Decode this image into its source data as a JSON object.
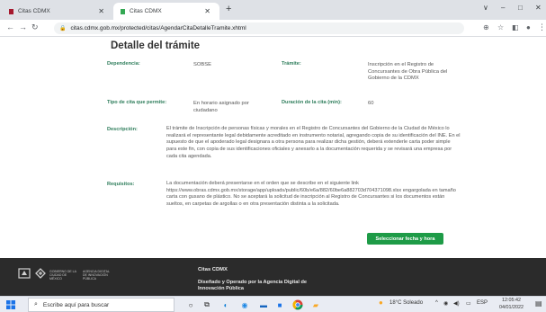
{
  "browser": {
    "tabs": [
      {
        "title": "Citas CDMX",
        "active": false
      },
      {
        "title": "Citas CDMX",
        "active": true
      }
    ],
    "new_tab_icon": "plus-icon",
    "url": "citas.cdmx.gob.mx/protected/citas/AgendarCitaDetalleTramite.xhtml",
    "window_controls": {
      "minimize": "∨",
      "restore": "–",
      "maximize": "□",
      "close": "✕"
    }
  },
  "page": {
    "title": "Detalle del trámite",
    "fields": {
      "dependencia_label": "Dependencia:",
      "dependencia_value": "SOBSE",
      "tramite_label": "Trámite:",
      "tramite_value": "Inscripción en el Registro de Concursantes de Obra Pública del Gobierno de la CDMX",
      "tipo_label": "Tipo de cita que permite:",
      "tipo_value": "En horario asignado por ciudadano",
      "duracion_label": "Duración de la cita (min):",
      "duracion_value": "60",
      "descripcion_label": "Descripción:",
      "descripcion_value": "El trámite de Inscripción de personas físicas y morales en el Registro de Concursantes del Gobierno de la Ciudad de México lo realizará el representante legal debidamente acreditado en instrumento notarial, agregando copia de su identificación del INE. En el supuesto de que el apoderado legal designara a otra persona para realizar dicha gestión, deberá extenderle carta poder simple para este fin, con copia de sus identificaciones oficiales y anexarlo a la documentación requerida y se revisará una empresa por cada cita agendada.",
      "requisitos_label": "Requisitos:",
      "requisitos_value": "La documentación deberá presentarse en el orden que se describe en el siguiente link https://www.obras.cdmx.gob.mx/storage/app/uploads/public/60b/e6a/882/60be6a882703d704371098.xlsx engargolada en tamaño carta con gusano de plástico. No se aceptará la solicitud de inscripción al Registro de Concursantes si los documentos están sueltos, en carpetas de argollas o en otra presentación distinta a la solicitada."
    },
    "cta_label": "Seleccionar fecha y hora"
  },
  "footer": {
    "logo1_text": "GOBIERNO DE LA CIUDAD DE MÉXICO",
    "logo2_text": "AGENCIA DIGITAL DE INNOVACIÓN PÚBLICA",
    "title": "Citas CDMX",
    "credit": "Diseñado y Operado por la Agencia Digital de Innovación Pública"
  },
  "taskbar": {
    "search_placeholder": "Escribe aquí para buscar",
    "weather": "18°C Soleado",
    "language": "ESP",
    "time": "12:05:42",
    "date": "04/01/2022"
  },
  "colors": {
    "label_green": "#2e7d5b",
    "cta_green": "#1e9b47",
    "footer_bg": "#2b2b2b",
    "tab_favicon_red": "#a6192e"
  }
}
